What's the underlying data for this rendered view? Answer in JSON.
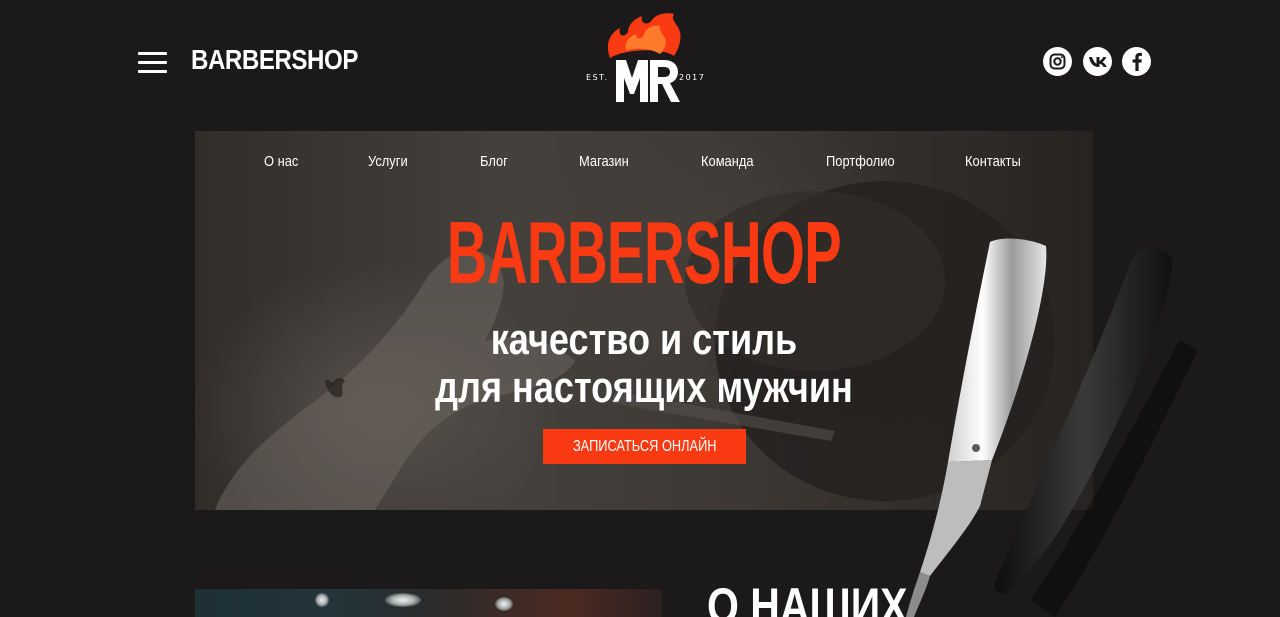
{
  "header": {
    "brand": "BARBERSHOP",
    "logo": {
      "text": "MR",
      "est_left": "EST.",
      "est_right": "2017"
    },
    "social": [
      {
        "name": "instagram-icon"
      },
      {
        "name": "vk-icon"
      },
      {
        "name": "facebook-icon"
      }
    ]
  },
  "nav": {
    "items": [
      {
        "label": "О нас"
      },
      {
        "label": "Услуги"
      },
      {
        "label": "Блог"
      },
      {
        "label": "Магазин"
      },
      {
        "label": "Команда"
      },
      {
        "label": "Портфолио"
      },
      {
        "label": "Контакты"
      }
    ]
  },
  "hero": {
    "title": "BARBERSHOP",
    "subtitle_line1": "качество и стиль",
    "subtitle_line2": "для настоящих мужчин",
    "cta": "ЗАПИСАТЬСЯ ОНЛАЙН"
  },
  "about": {
    "title": "О НАШИХ"
  },
  "colors": {
    "background": "#1b1919",
    "accent": "#fa3a13",
    "text": "#ffffff"
  }
}
